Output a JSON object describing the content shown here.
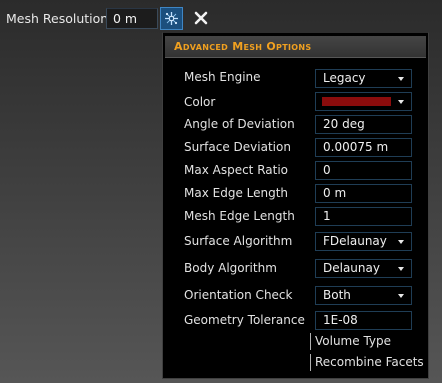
{
  "toolbar": {
    "mesh_resolution_label": "Mesh Resolution",
    "mesh_resolution_value": "0 m",
    "options_icon": "mesh-settings-icon",
    "close_icon": "close-icon",
    "accent_color": "#3f86c4"
  },
  "panel": {
    "title": "Advanced Mesh Options",
    "title_color": "#f0a020",
    "rows": {
      "mesh_engine": {
        "label": "Mesh Engine",
        "value": "Legacy"
      },
      "color": {
        "label": "Color",
        "value_color": "#8b0c0c"
      },
      "angle_of_deviation": {
        "label": "Angle of Deviation",
        "value": "20 deg"
      },
      "surface_deviation": {
        "label": "Surface Deviation",
        "value": "0.00075 m"
      },
      "max_aspect_ratio": {
        "label": "Max Aspect Ratio",
        "value": "0"
      },
      "max_edge_length": {
        "label": "Max Edge Length",
        "value": "0 m"
      },
      "mesh_edge_length": {
        "label": "Mesh Edge Length",
        "value": "1"
      },
      "surface_algorithm": {
        "label": "Surface Algorithm",
        "value": "FDelaunay"
      },
      "body_algorithm": {
        "label": "Body Algorithm",
        "value": "Delaunay"
      },
      "orientation_check": {
        "label": "Orientation Check",
        "value": "Both"
      },
      "geometry_tolerance": {
        "label": "Geometry Tolerance",
        "value": "1E-08"
      }
    },
    "checkboxes": {
      "volume_type": {
        "label": "Volume Type"
      },
      "recombine_facets": {
        "label": "Recombine Facets"
      }
    }
  }
}
